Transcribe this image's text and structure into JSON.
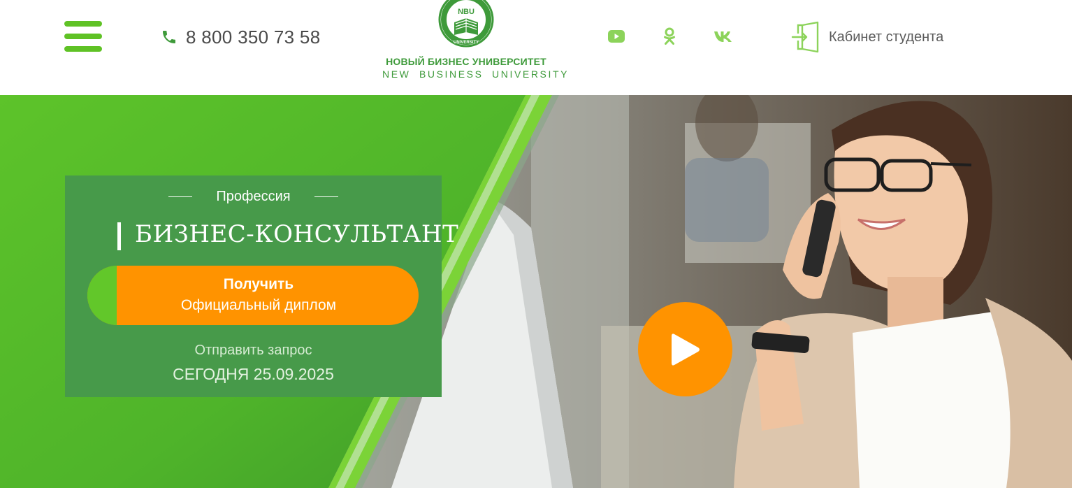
{
  "header": {
    "menu_label": "",
    "phone": "8 800 350 73 58",
    "logo": {
      "emblem_text": "NBU",
      "emblem_ring_text": "UNIVERSITY",
      "line1": "НОВЫЙ БИЗНЕС УНИВЕРСИТЕТ",
      "line2": "NEW BUSINESS UNIVERSITY"
    },
    "social": [
      {
        "name": "youtube",
        "icon": "youtube-icon"
      },
      {
        "name": "odnoklassniki",
        "icon": "odnoklassniki-icon"
      },
      {
        "name": "vk",
        "icon": "vk-icon"
      }
    ],
    "cabinet_label": "Кабинет студента"
  },
  "hero": {
    "subtitle": "Профессия",
    "title": "БИЗНЕС-КОНСУЛЬТАНТ",
    "cta": {
      "line1": "Получить",
      "line2": "Официальный диплом"
    },
    "request_label": "Отправить запрос",
    "request_date": "СЕГОДНЯ 25.09.2025"
  },
  "colors": {
    "brand_green": "#5fc225",
    "logo_green": "#3e9a3a",
    "panel_green": "#479a4a",
    "accent_orange": "#ff9300",
    "social_green": "#8cd35a"
  }
}
